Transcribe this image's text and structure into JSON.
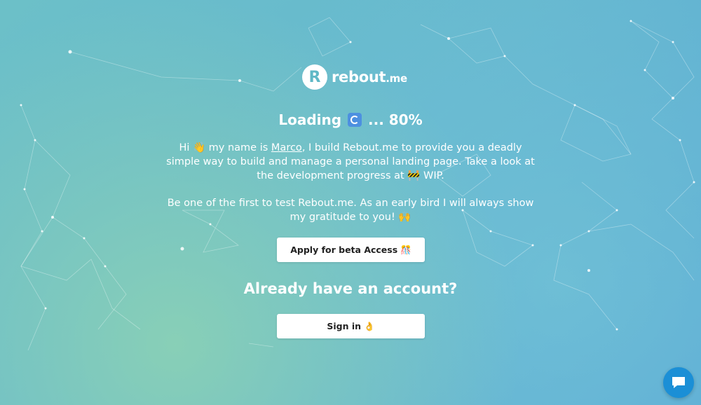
{
  "brand": {
    "logo_letter": "R",
    "name": "rebout",
    "tld": ".me"
  },
  "loading": {
    "prefix": "Loading",
    "icon": "refresh-icon",
    "suffix": "... 80%",
    "progress_percent": 80
  },
  "intro": {
    "greeting": "Hi",
    "wave_emoji": "👋",
    "before_name": "my name is",
    "name": "Marco",
    "after_name": ", I build Rebout.me to provide you a deadly simple way to build and manage a personal landing page. Take a look at the development progress at",
    "wip_emoji": "🚧",
    "wip_label": "WIP."
  },
  "early_bird": {
    "text": "Be one of the first to test Rebout.me. As an early bird I will always show my gratitude to you!",
    "emoji": "🙌"
  },
  "beta_button": {
    "label": "Apply for beta Access",
    "emoji": "🎊"
  },
  "account": {
    "heading": "Already have an account?"
  },
  "signin_button": {
    "label": "Sign in",
    "emoji": "👌"
  },
  "colors": {
    "background_start": "#6cc0c8",
    "background_end": "#59a8d6",
    "text": "#ffffff",
    "button_bg": "#ffffff",
    "chat_button": "#1b8fd6"
  }
}
